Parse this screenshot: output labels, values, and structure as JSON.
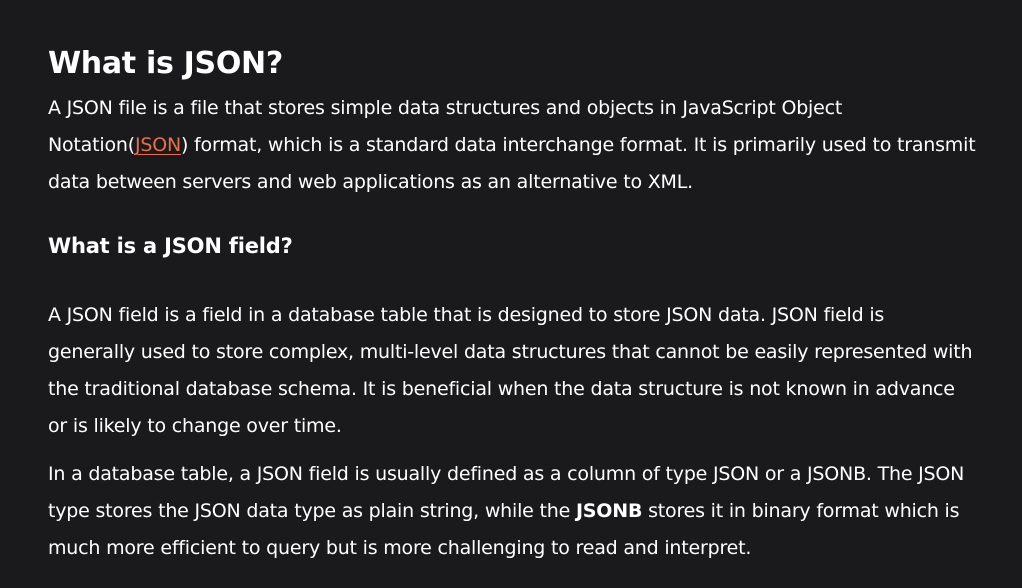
{
  "article": {
    "title": "What is JSON?",
    "intro": {
      "before_link": "A JSON file is a file that stores simple data structures and objects in JavaScript Object Notation(",
      "link_text": "JSON",
      "after_link": ") format, which is a standard data interchange format. It is primarily used to transmit data between servers and web applications as an alternative to XML."
    },
    "section": {
      "heading": "What is a JSON field?",
      "paragraph_1": "A JSON field is a field in a database table that is designed to store JSON data. JSON field is generally used to store complex, multi-level data structures that cannot be easily represented with the traditional database schema. It is beneficial when the data structure is not known in advance or is likely to change over time.",
      "paragraph_2": {
        "before_strong": "In a database table, a JSON field is usually defined as a column of type JSON or a JSONB. The JSON type stores the JSON data type as plain string, while the ",
        "strong": "JSONB",
        "after_strong": " stores it in binary format which is much more efficient to query but is more challenging to read and interpret."
      }
    }
  },
  "colors": {
    "background": "#1a1a1d",
    "text": "#ffffff",
    "link": "#e86f4a"
  }
}
